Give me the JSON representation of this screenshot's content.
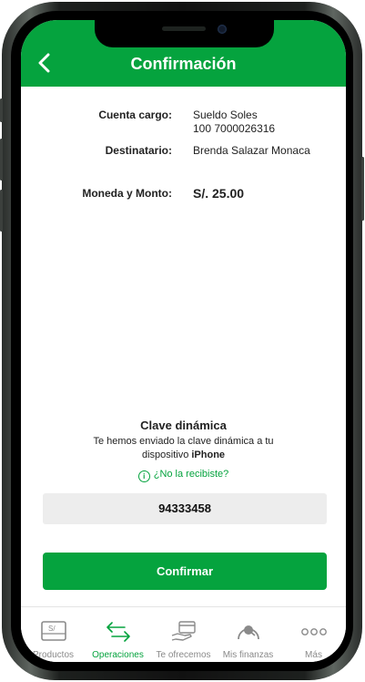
{
  "header": {
    "title": "Confirmación",
    "back_icon": "chevron-left-icon"
  },
  "summary": {
    "cuenta_cargo_label": "Cuenta cargo:",
    "cuenta_cargo_name": "Sueldo Soles",
    "cuenta_cargo_number": "100 7000026316",
    "destinatario_label": "Destinatario:",
    "destinatario_value": "Brenda Salazar Monaca",
    "monto_label": "Moneda y Monto:",
    "monto_value": "S/. 25.00"
  },
  "clave": {
    "title": "Clave dinámica",
    "desc_prefix": "Te hemos enviado la clave dinámica a tu dispositivo ",
    "device": "iPhone",
    "resend_link": "¿No la recibiste?",
    "code": "94333458"
  },
  "confirm_button": "Confirmar",
  "tabs": [
    {
      "label": "Productos",
      "icon": "wallet-soles-icon",
      "active": false
    },
    {
      "label": "Operaciones",
      "icon": "transfer-arrows-icon",
      "active": true
    },
    {
      "label": "Te ofrecemos",
      "icon": "hand-card-icon",
      "active": false
    },
    {
      "label": "Mis finanzas",
      "icon": "gauge-icon",
      "active": false
    },
    {
      "label": "Más",
      "icon": "more-dots-icon",
      "active": false
    }
  ],
  "colors": {
    "brand_green": "#05a33e",
    "field_gray": "#ededed"
  }
}
